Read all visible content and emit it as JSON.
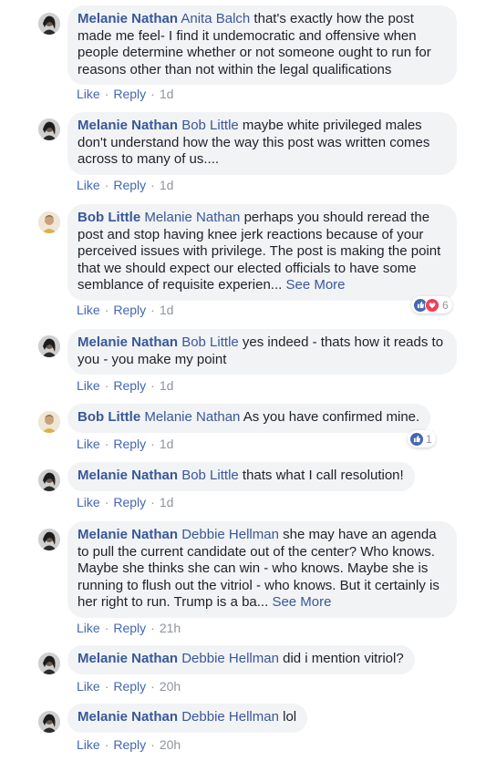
{
  "colors": {
    "link": "#385898",
    "bubble": "#f2f3f5",
    "meta": "#90949c"
  },
  "labels": {
    "like": "Like",
    "reply": "Reply",
    "dot": "·",
    "see_more": "See More"
  },
  "comments": [
    {
      "author": "Melanie Nathan",
      "mention": "Anita Balch",
      "text": " that's exactly how the post made me feel- I find it undemocratic and offensive when people determine whether or not someone ought to run for reasons other than not within the legal qualifications",
      "time": "1d"
    },
    {
      "author": "Melanie Nathan",
      "mention": "Bob Little",
      "text": " maybe white privileged males don't understand how the way this post was written comes across to many of us....",
      "time": "1d"
    },
    {
      "author": "Bob Little",
      "mention": "Melanie Nathan",
      "text": " perhaps you should reread the post and stop having knee jerk reactions because of your perceived issues with privilege. The post is making the point that we should expect our elected officials to have some semblance of requisite experien... ",
      "time": "1d",
      "reaction_count": "6"
    },
    {
      "author": "Melanie Nathan",
      "mention": "Bob Little",
      "text": " yes indeed - thats how it reads to you - you make my point",
      "time": "1d"
    },
    {
      "author": "Bob Little",
      "mention": "Melanie Nathan",
      "text": " As you have confirmed mine.",
      "time": "1d",
      "reaction_count": "1"
    },
    {
      "author": "Melanie Nathan",
      "mention": "Bob Little",
      "text": " thats what I call resolution!",
      "time": "1d"
    },
    {
      "author": "Melanie Nathan",
      "mention": "Debbie Hellman",
      "text": " she may have an agenda to pull the current candidate out of the center? Who knows. Maybe she thinks she can win - who knows. Maybe she is running to flush out the vitriol - who knows. But it certainly is her right to run. Trump is a ba... ",
      "time": "21h"
    },
    {
      "author": "Melanie Nathan",
      "mention": "Debbie Hellman",
      "text": " did i mention vitriol?",
      "time": "20h"
    },
    {
      "author": "Melanie Nathan",
      "mention": "Debbie Hellman",
      "text": " lol",
      "time": "20h"
    }
  ]
}
